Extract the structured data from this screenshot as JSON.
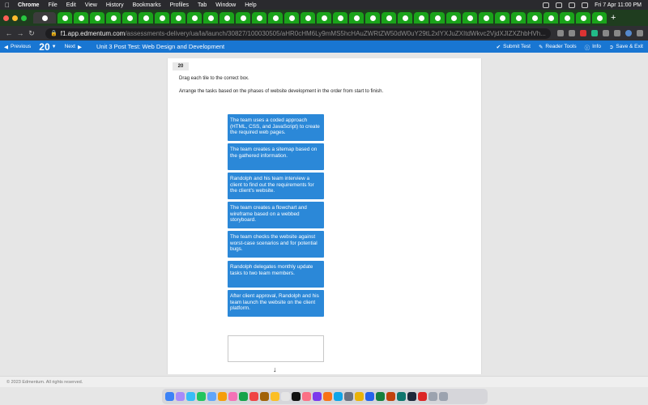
{
  "menubar": {
    "app": "Chrome",
    "items": [
      "File",
      "Edit",
      "View",
      "History",
      "Bookmarks",
      "Profiles",
      "Tab",
      "Window",
      "Help"
    ],
    "datetime": "Fri 7 Apr  11:00 PM"
  },
  "browser": {
    "url_domain": "f1.app.edmentum.com",
    "url_path": "/assessments-delivery/ua/la/launch/30827/100030505/aHR0cHM6Ly9mMS5hcHAuZWRtZW50dW0uY29tL2xlYXJuZXItdWkvc2VjdXJlZXZhbHVh..."
  },
  "toolbar": {
    "previous": "Previous",
    "question_number": "20",
    "next": "Next",
    "title": "Unit 3 Post Test: Web Design and Development",
    "submit": "Submit Test",
    "reader": "Reader Tools",
    "info": "Info",
    "save_exit": "Save & Exit"
  },
  "question": {
    "badge": "20",
    "instruction1": "Drag each tile to the correct box.",
    "instruction2": "Arrange the tasks based on the phases of website development in the order from start to finish.",
    "tiles": [
      "The team uses a coded approach (HTML, CSS, and JavaScript) to create the required web pages.",
      "The team creates a sitemap based on the gathered information.",
      "Randolph and his team interview a client to find out the requirements for the client's website.",
      "The team creates a flowchart and wireframe based on a webbed storyboard.",
      "The team checks the website against worst-case scenarios and for potential bugs.",
      "Randolph delegates monthly update tasks to two team members.",
      "After client approval, Randolph and his team launch the website on the client platform."
    ]
  },
  "footer": {
    "copyright": "© 2023 Edmentum. All rights reserved."
  },
  "colors": {
    "accent": "#1976d2",
    "tile": "#2b88d8"
  }
}
